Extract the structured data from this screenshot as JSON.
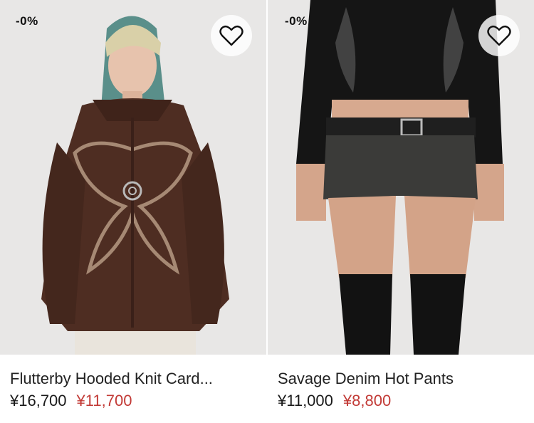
{
  "products": [
    {
      "badge": "-0%",
      "title": "Flutterby Hooded Knit Card...",
      "price_original": "¥16,700",
      "price_sale": "¥11,700"
    },
    {
      "badge": "-0%",
      "title": "Savage Denim Hot Pants",
      "price_original": "¥11,000",
      "price_sale": "¥8,800"
    }
  ],
  "colors": {
    "sale_price": "#c23a36",
    "photo_background": "#e8e7e6"
  },
  "icons": {
    "wishlist": "heart-icon"
  }
}
